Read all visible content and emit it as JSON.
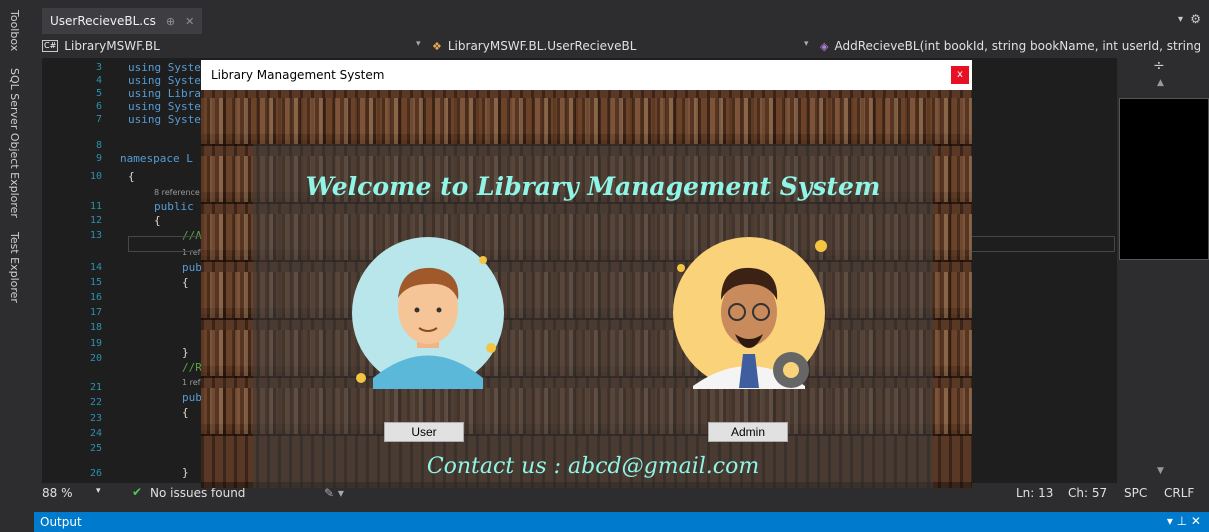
{
  "sidebar": {
    "tabs": [
      "Toolbox",
      "SQL Server Object Explorer",
      "Test Explorer"
    ]
  },
  "tab": {
    "filename": "UserRecieveBL.cs",
    "pin": "⊕",
    "close": "✕"
  },
  "nav": {
    "project": "LibraryMSWF.BL",
    "class": "LibraryMSWF.BL.UserRecieveBL",
    "member": "AddRecieveBL(int bookId, string bookName, int userId, string"
  },
  "editor": {
    "line_numbers": [
      "3",
      "4",
      "5",
      "6",
      "7",
      "8",
      "9",
      "10",
      "11",
      "12",
      "13",
      "14",
      "15",
      "16",
      "17",
      "18",
      "19",
      "20",
      "21",
      "22",
      "23",
      "24",
      "25",
      "26"
    ],
    "code": {
      "l3": "using Syste",
      "l4": "using Syste",
      "l5": "using Libra",
      "l6": "using Syste",
      "l7": "using Syste",
      "l9": "namespace L",
      "l10": "{",
      "l11": "public",
      "l12": "{",
      "l13": "//A",
      "l14": "pub",
      "l15": "{",
      "l19": "}",
      "l20": "//R",
      "l21": "pub",
      "l22": "{",
      "l25b": "}"
    },
    "refs": {
      "r1": "8 reference",
      "r2": "1 ref",
      "r3": "1 ref"
    }
  },
  "dialog": {
    "title": "Library Management System",
    "close": "x",
    "welcome": "Welcome to Library Management System",
    "user_button": "User",
    "admin_button": "Admin",
    "contact": "Contact us : abcd@gmail.com"
  },
  "status": {
    "zoom": "88 %",
    "issues": "No issues found",
    "line": "Ln: 13",
    "col": "Ch: 57",
    "spc": "SPC",
    "eol": "CRLF"
  },
  "output": {
    "title": "Output",
    "controls": "▾ ⊥ ✕"
  },
  "colors": {
    "accent": "#007acc",
    "welcome_text": "#8ff5e6",
    "close_red": "#e81123"
  }
}
